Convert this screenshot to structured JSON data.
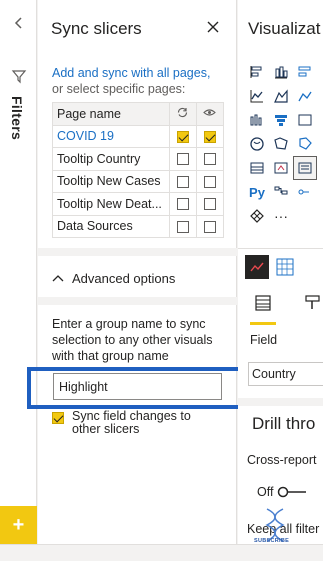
{
  "filters_rail": {
    "label": "Filters",
    "add_icon": "plus-icon",
    "add_glyph": "+",
    "accent": "#f2c811"
  },
  "sync_pane": {
    "title": "Sync slicers",
    "close_icon": "close-icon",
    "desc_link": "Add and sync with all pages,",
    "desc_rest": "or select specific pages:",
    "table": {
      "header_page": "Page name",
      "header_sync_icon": "sync-icon",
      "header_visible_icon": "eye-icon",
      "rows": [
        {
          "name": "COVID 19",
          "sync": true,
          "visible": true
        },
        {
          "name": "Tooltip Country",
          "sync": false,
          "visible": false
        },
        {
          "name": "Tooltip New Cases",
          "sync": false,
          "visible": false
        },
        {
          "name": "Tooltip New Deat...",
          "sync": false,
          "visible": false
        },
        {
          "name": "Data Sources",
          "sync": false,
          "visible": false
        }
      ]
    },
    "advanced_label": "Advanced options",
    "group_desc": "Enter a group name to sync selection to any other visuals with that group name",
    "group_name_value": "Highlight",
    "sync_field_label": "Sync field changes to other slicers",
    "sync_field_checked": true,
    "link_color": "#1a6fc4",
    "focus_color": "#1f5fc0"
  },
  "viz_pane": {
    "title": "Visualizat",
    "icons": [
      "stacked-bar-icon",
      "stacked-column-icon",
      "clustered-bar-icon",
      "clustered-column-icon",
      "line-chart-icon",
      "area-chart-icon",
      "stacked-area-icon",
      "line-column-icon",
      "ribbon-chart-icon",
      "funnel-icon",
      "waterfall-icon",
      "scatter-icon",
      "globe-map-icon",
      "filled-map-icon",
      "shape-map-icon",
      "pie-icon",
      "table-icon",
      "kpi-icon",
      "slicer-icon",
      "gauge-icon",
      "python-icon",
      "decomposition-icon",
      "key-influencers-icon",
      "card-icon",
      "diamond-icon",
      "more-icon"
    ],
    "python_label": "Py",
    "more_label": "···",
    "tabs": [
      "fields-tab-icon",
      "format-paint-icon"
    ],
    "field_label": "Field",
    "field_value": "Country",
    "drill_title": "Drill thro",
    "cross_report_label": "Cross-report",
    "toggle_label": "Off",
    "keep_filters_label": "Keep all filter",
    "watermark_text": "SUBSCRIBE"
  }
}
